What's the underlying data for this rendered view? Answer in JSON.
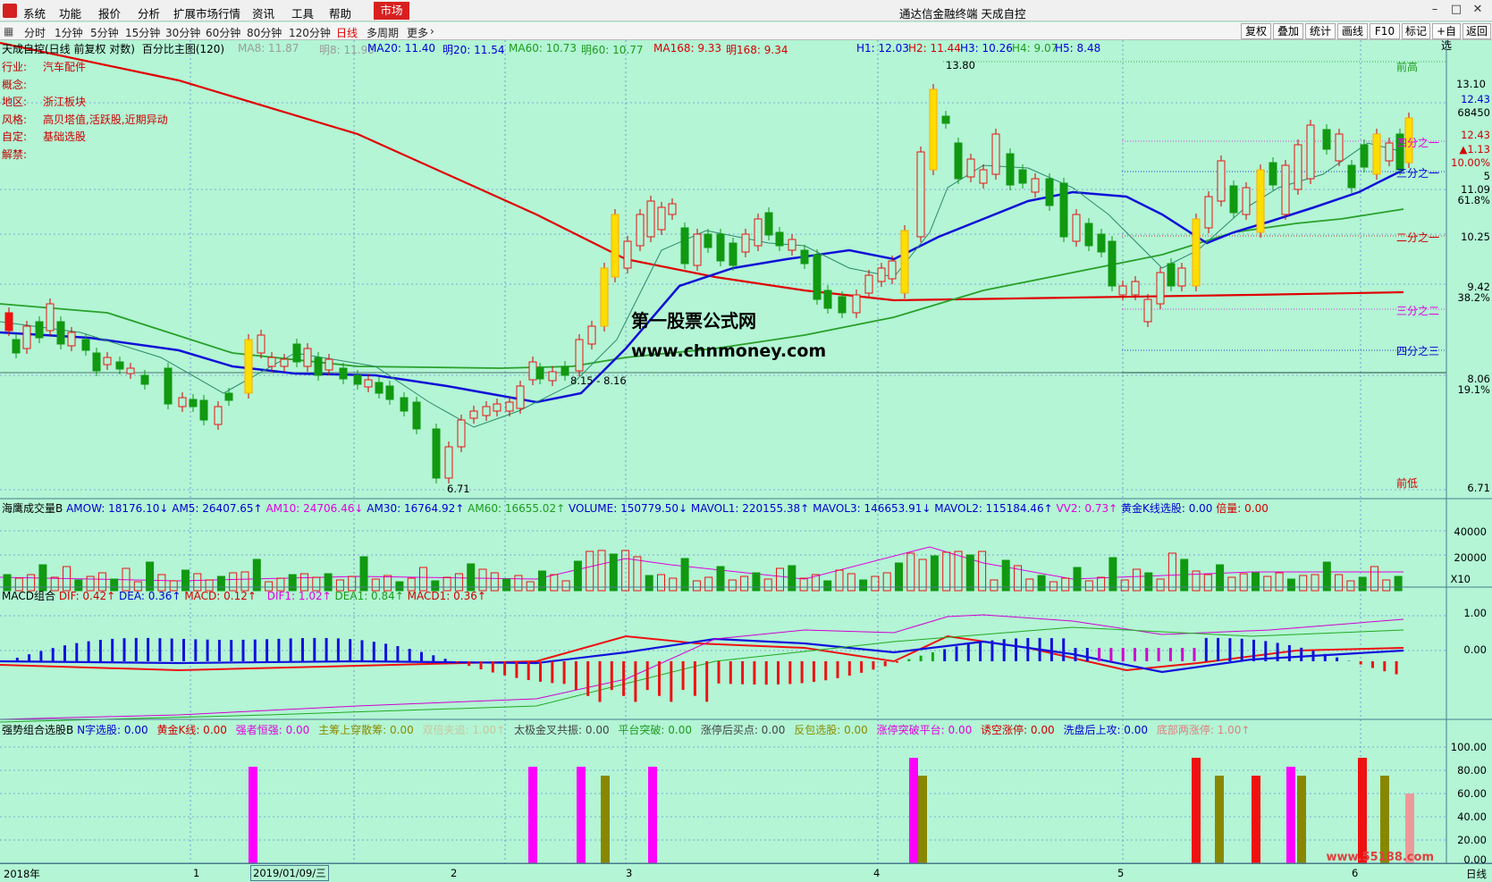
{
  "menu": {
    "items": [
      "系统",
      "功能",
      "报价",
      "分析",
      "扩展市场行情",
      "资讯",
      "工具",
      "帮助"
    ],
    "market": "市场",
    "title": "通达信金融终端  天成自控"
  },
  "periods": [
    "分时",
    "1分钟",
    "5分钟",
    "15分钟",
    "30分钟",
    "60分钟",
    "80分钟",
    "120分钟",
    "日线",
    "多周期",
    "更多"
  ],
  "right_buttons": [
    "复权",
    "叠加",
    "统计",
    "画线",
    "F10",
    "标记",
    "+自选",
    "返回"
  ],
  "stock_line": "天成自控(日线 前复权 对数)",
  "indicator_name": "百分比主图(120)",
  "ma_values": [
    {
      "t": "MA8: 11.87",
      "c": "#9b9b9b"
    },
    {
      "t": "明8: 11.90",
      "c": "#9b9b9b"
    },
    {
      "t": "MA20: 11.40",
      "c": "#0000d8"
    },
    {
      "t": "明20: 11.54",
      "c": "#0000d8"
    },
    {
      "t": "MA60: 10.73",
      "c": "#1d9b1d"
    },
    {
      "t": "明60: 10.77",
      "c": "#1d9b1d"
    },
    {
      "t": "MA168: 9.33",
      "c": "#d80000"
    },
    {
      "t": "明168: 9.34",
      "c": "#d80000"
    }
  ],
  "h_values": [
    "H1: 12.03",
    "H2: 11.44",
    "H3: 10.26",
    "H4: 9.07",
    "H5: 8.48"
  ],
  "info": [
    {
      "k": "行业:",
      "v": "汽车配件"
    },
    {
      "k": "概念:",
      "v": ""
    },
    {
      "k": "地区:",
      "v": "浙江板块"
    },
    {
      "k": "风格:",
      "v": "高贝塔值,活跃股,近期异动"
    },
    {
      "k": "自定:",
      "v": "基础选股"
    },
    {
      "k": "解禁:",
      "v": ""
    }
  ],
  "price_axis": [
    {
      "v": "13.10"
    },
    {
      "v": "12.43"
    },
    {
      "v": "68450"
    },
    {
      "v": "12.43"
    },
    {
      "v": "▲1.13"
    },
    {
      "v": "10.00%"
    },
    {
      "v": "5"
    },
    {
      "v": "11.09"
    },
    {
      "v": "61.8%"
    },
    {
      "v": "10.25"
    },
    {
      "v": "9.42"
    },
    {
      "v": "38.2%"
    },
    {
      "v": "8.06"
    },
    {
      "v": "19.1%"
    },
    {
      "v": "6.71"
    }
  ],
  "fib_labels": [
    "前高",
    "四分之一",
    "三分之一",
    "二分之一",
    "三分之二",
    "四分之三",
    "前低"
  ],
  "price_notes": [
    "13.80",
    "6.71",
    "8.15 - 8.16"
  ],
  "watermark": [
    "第一股票公式网",
    "www.chnmoney.com"
  ],
  "volume_pane": {
    "title": "海鹰成交量B",
    "items": [
      {
        "t": "AMOW: 18176.10↓",
        "c": "#0000d0"
      },
      {
        "t": "AM5: 26407.65↑",
        "c": "#0000d0"
      },
      {
        "t": "AM10: 24706.46↓",
        "c": "#e000e0"
      },
      {
        "t": "AM30: 16764.92↑",
        "c": "#0000d0"
      },
      {
        "t": "AM60: 16655.02↑",
        "c": "#1d9b1d"
      },
      {
        "t": "VOLUME: 150779.50↓",
        "c": "#0000d0"
      },
      {
        "t": "MAVOL1: 220155.38↑",
        "c": "#0000d0"
      },
      {
        "t": "MAVOL3: 146653.91↓",
        "c": "#0000d0"
      },
      {
        "t": "MAVOL2: 115184.46↑",
        "c": "#0000d0"
      },
      {
        "t": "VV2: 0.73↑",
        "c": "#e000e0"
      },
      {
        "t": "黄金K线选股: 0.00",
        "c": "#0000d0"
      },
      {
        "t": "倍量: 0.00",
        "c": "#d00000"
      }
    ],
    "axis": [
      "40000",
      "20000",
      "X10"
    ]
  },
  "macd_pane": {
    "title": "MACD组合",
    "items": [
      {
        "t": "DIF: 0.42↑",
        "c": "#d00000"
      },
      {
        "t": "DEA: 0.36↑",
        "c": "#0000d0"
      },
      {
        "t": "MACD: 0.12↑",
        "c": "#d00000"
      },
      {
        "t": "DIF1: 1.02↑",
        "c": "#e000e0"
      },
      {
        "t": "DEA1: 0.84↑",
        "c": "#1d9b1d"
      },
      {
        "t": "MACD1: 0.36↑",
        "c": "#d00000"
      }
    ],
    "axis": [
      "1.00",
      "0.00"
    ]
  },
  "signal_pane": {
    "title": "强势组合选股B",
    "items": [
      {
        "t": "N字选股: 0.00",
        "c": "#0000d0"
      },
      {
        "t": "黄金K线: 0.00",
        "c": "#d00000"
      },
      {
        "t": "强者恒强: 0.00",
        "c": "#e000e0"
      },
      {
        "t": "主筹上穿散筹: 0.00",
        "c": "#8b8b00"
      },
      {
        "t": "双倍夹追: 1.00↑",
        "c": "#c8c8a0"
      },
      {
        "t": "太极金叉共振: 0.00",
        "c": "#444444"
      },
      {
        "t": "平台突破: 0.00",
        "c": "#1d9b1d"
      },
      {
        "t": "涨停后买点: 0.00",
        "c": "#444444"
      },
      {
        "t": "反包选股: 0.00",
        "c": "#8b8b00"
      },
      {
        "t": "涨停突破平台: 0.00",
        "c": "#e000e0"
      },
      {
        "t": "诱空涨停: 0.00",
        "c": "#d00000"
      },
      {
        "t": "洗盘后上攻: 0.00",
        "c": "#0000d0"
      },
      {
        "t": "底部两涨停: 1.00↑",
        "c": "#e08080"
      }
    ],
    "axis": [
      "100.00",
      "80.00",
      "60.00",
      "40.00",
      "20.00",
      "0.00"
    ]
  },
  "date_axis": [
    "2018年",
    "1",
    "2019/01/09/三",
    "2",
    "3",
    "4",
    "5",
    "6",
    "日线"
  ],
  "site_watermark": "www.55188.com"
}
